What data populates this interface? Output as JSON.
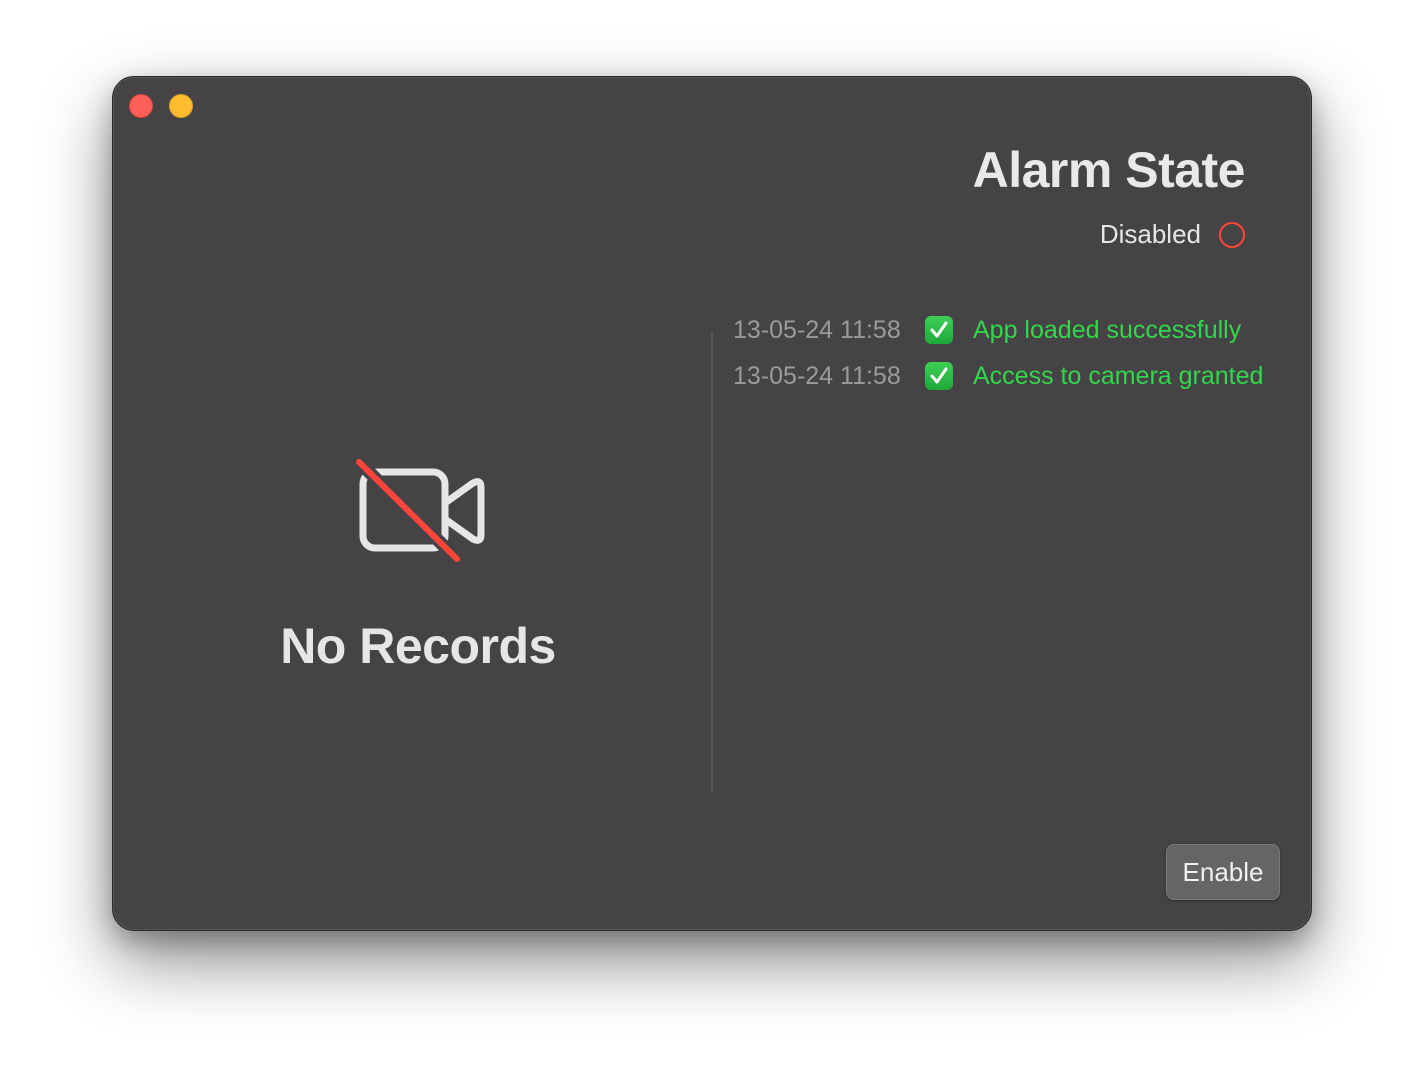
{
  "window": {
    "controls": [
      "close",
      "minimize"
    ]
  },
  "recordings": {
    "empty_icon": "video-slash-icon",
    "empty_label": "No Records"
  },
  "alarm": {
    "title": "Alarm State",
    "status_label": "Disabled",
    "status_icon": "status-ring-icon",
    "status_color": "#ff453a"
  },
  "log": {
    "entries": [
      {
        "time": "13-05-24 11:58",
        "icon": "check-mark-icon",
        "message": "App loaded successfully"
      },
      {
        "time": "13-05-24 11:58",
        "icon": "check-mark-icon",
        "message": "Access to camera granted"
      }
    ],
    "message_color": "#32d74b"
  },
  "actions": {
    "enable_label": "Enable"
  }
}
